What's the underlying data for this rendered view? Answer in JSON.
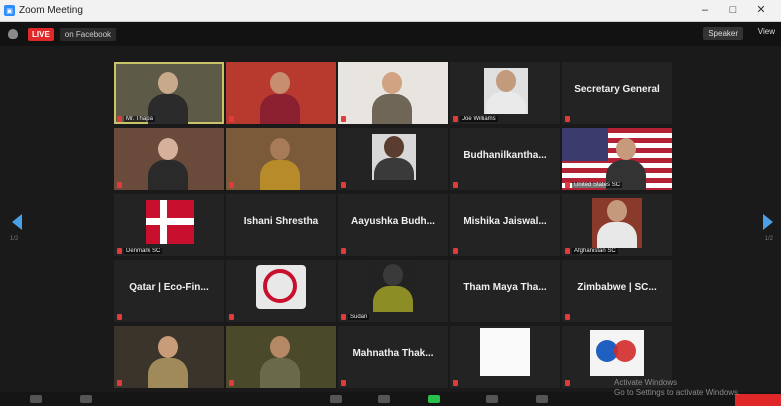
{
  "window": {
    "title": "Zoom Meeting",
    "minimize": "–",
    "maximize": "□",
    "close": "✕"
  },
  "topbar": {
    "live_label": "LIVE",
    "live_target": "on Facebook",
    "speaker_view": "Speaker",
    "view_label": "View"
  },
  "tiles": [
    {
      "name": "Mr. Thapa",
      "big": ""
    },
    {
      "name": "",
      "big": ""
    },
    {
      "name": "",
      "big": ""
    },
    {
      "name": "Joe Williams",
      "big": ""
    },
    {
      "name": "",
      "big": "Secretary General"
    },
    {
      "name": "",
      "big": ""
    },
    {
      "name": "",
      "big": ""
    },
    {
      "name": "",
      "big": ""
    },
    {
      "name": "",
      "big": "Budhanilkantha..."
    },
    {
      "name": "United States SC",
      "big": ""
    },
    {
      "name": "Denmark SC",
      "big": ""
    },
    {
      "name": "",
      "big": "Ishani Shrestha"
    },
    {
      "name": "",
      "big": "Aayushka Budh..."
    },
    {
      "name": "",
      "big": "Mishika Jaiswal..."
    },
    {
      "name": "Afghanistan SC",
      "big": ""
    },
    {
      "name": "",
      "big": "Qatar | Eco-Fin..."
    },
    {
      "name": "",
      "big": ""
    },
    {
      "name": "Sudan",
      "big": ""
    },
    {
      "name": "",
      "big": "Tham Maya Tha..."
    },
    {
      "name": "",
      "big": "Zimbabwe | SC..."
    },
    {
      "name": "",
      "big": ""
    },
    {
      "name": "",
      "big": ""
    },
    {
      "name": "",
      "big": "Mahnatha Thak..."
    },
    {
      "name": "",
      "big": ""
    },
    {
      "name": "",
      "big": ""
    }
  ],
  "pager": {
    "left": "1/2",
    "right": "1/2"
  },
  "colors": {
    "live": "#e02828",
    "nav_arrow": "#4aa0e6",
    "active_border": "#c9c36a",
    "unmute_green": "#27c04a"
  },
  "watermark": {
    "line1": "Activate Windows",
    "line2": "Go to Settings to activate Windows."
  }
}
